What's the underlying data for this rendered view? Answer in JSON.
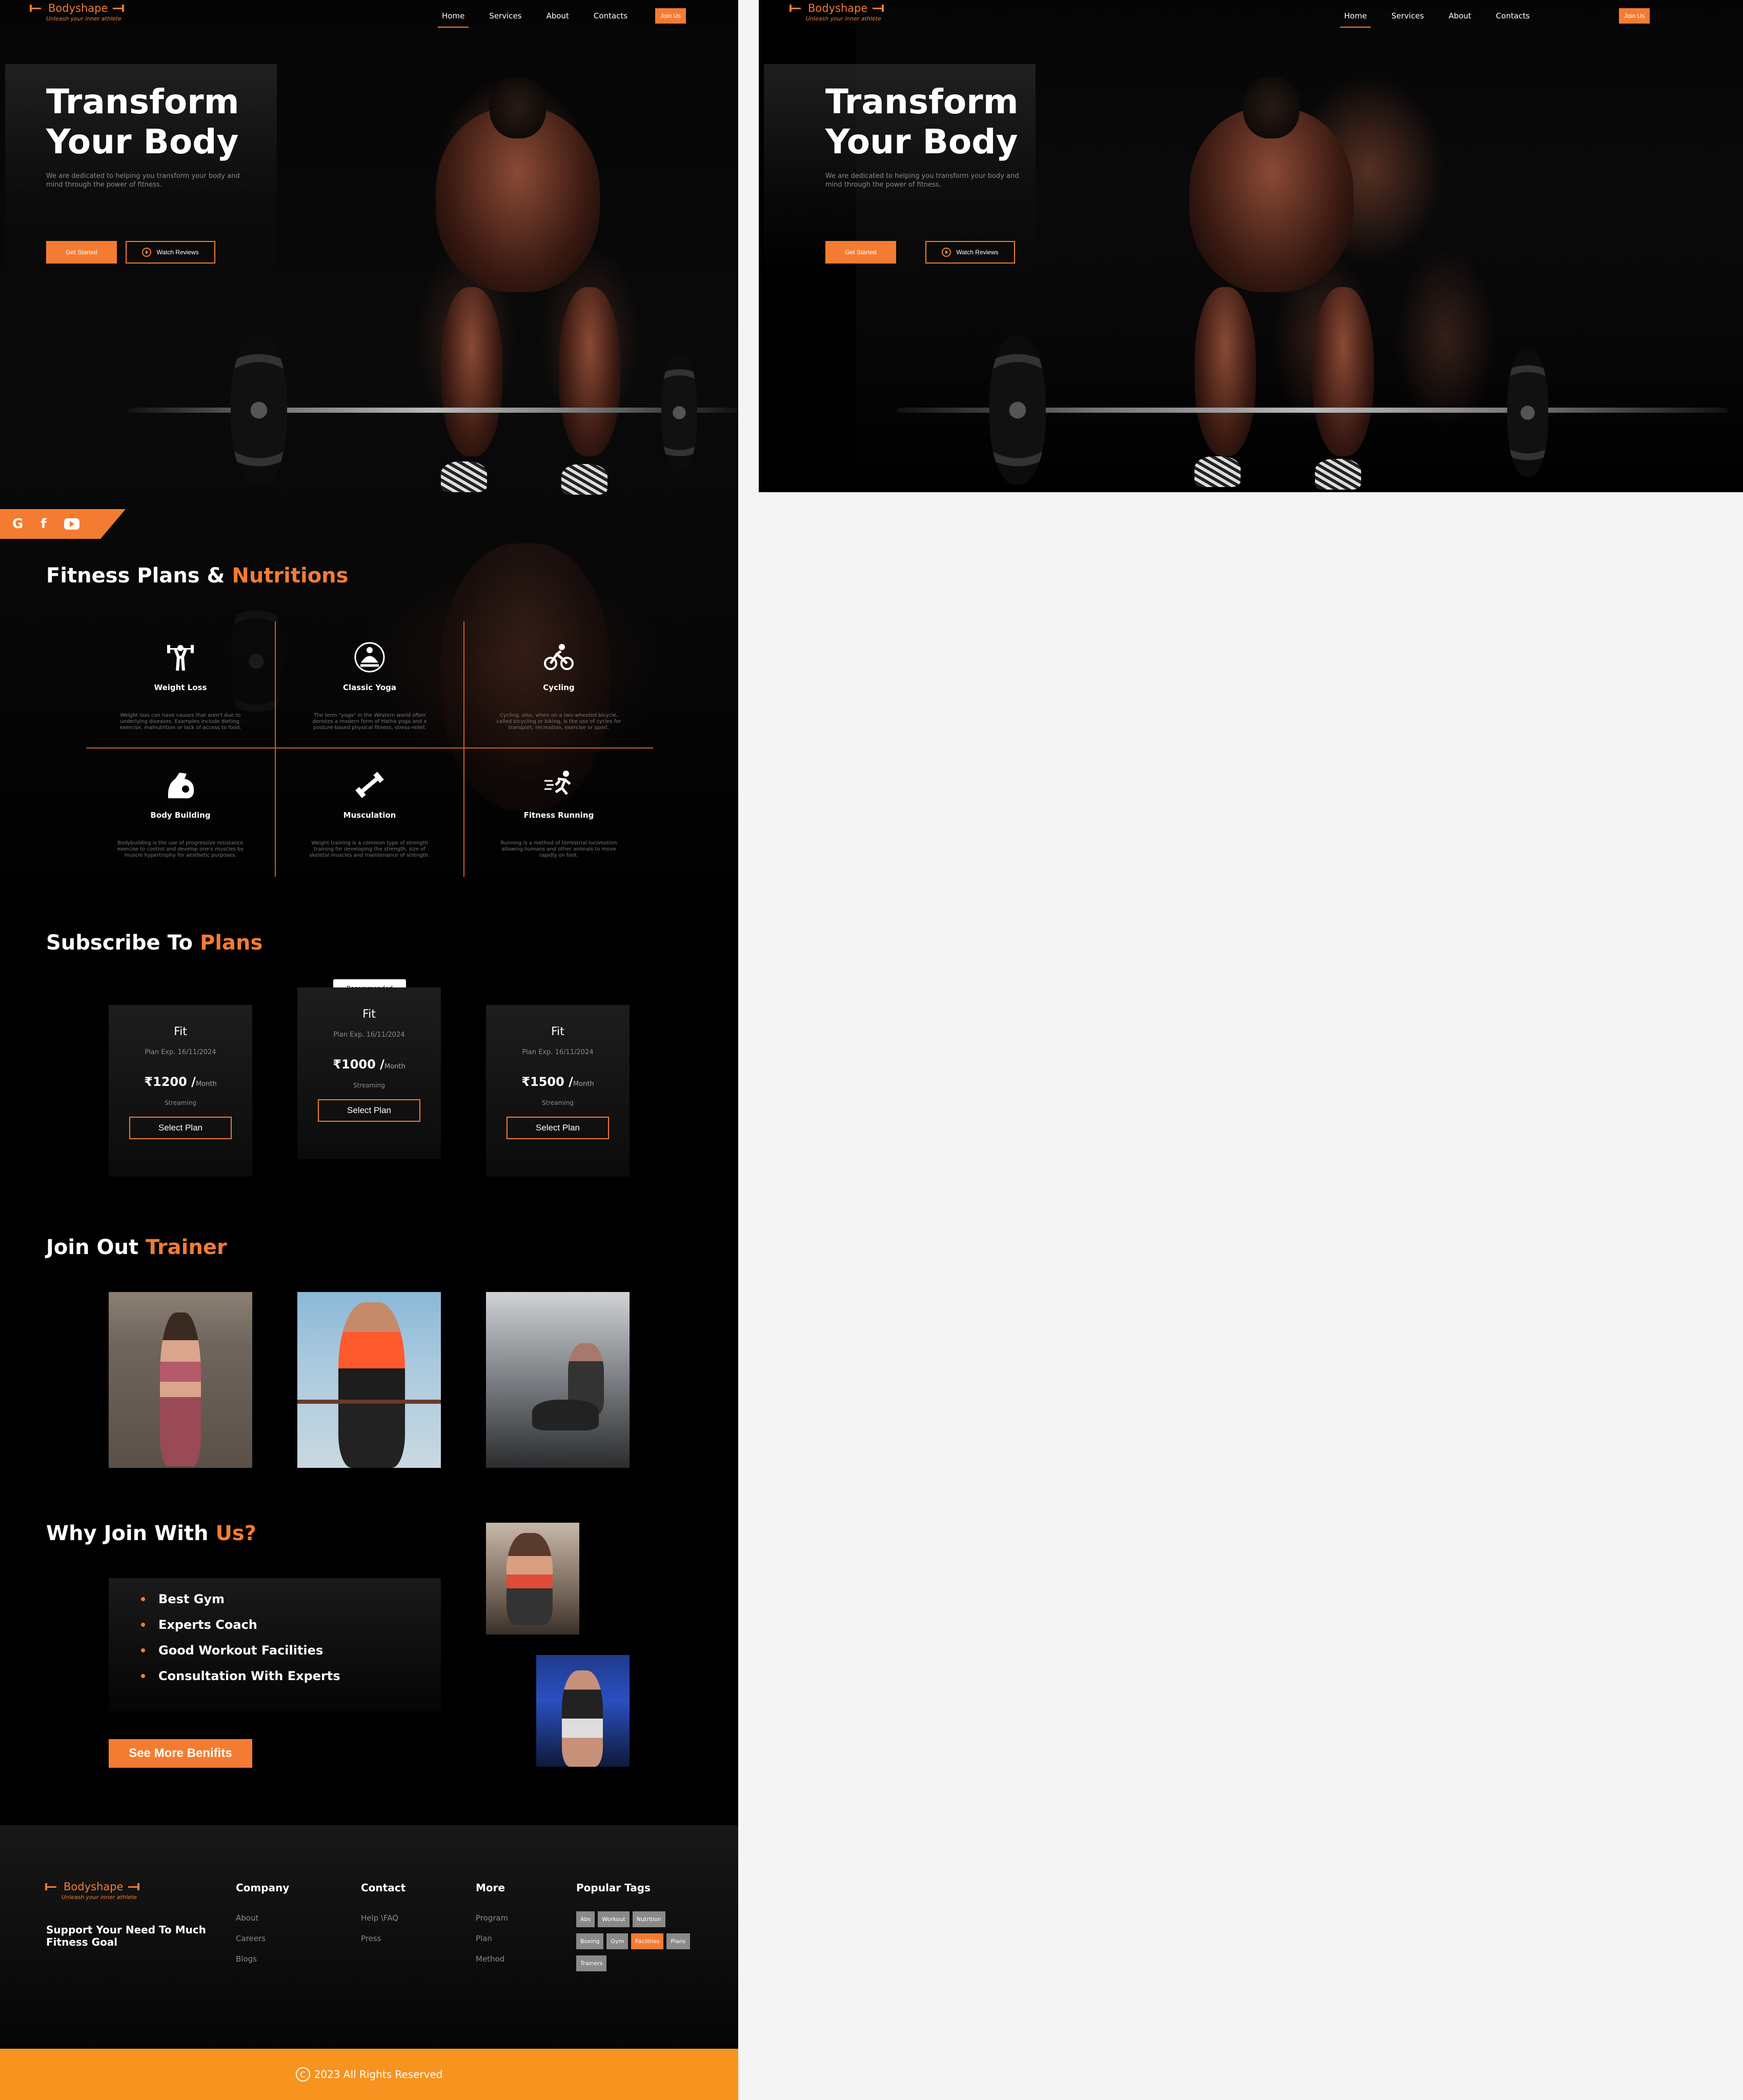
{
  "brand": {
    "name": "Bodyshape",
    "tagline": "Unleash your inner athlete"
  },
  "nav": {
    "items": [
      "Home",
      "Services",
      "About",
      "Contacts"
    ],
    "active": "Home",
    "cta": "Join Us"
  },
  "hero": {
    "title": "Transform Your Body",
    "subtitle": "We are dedicated to helping you transform your body and mind through the power of fitness.",
    "primary_button": "Get Started",
    "secondary_button": "Watch Reviews"
  },
  "social": {
    "icons": [
      "google-icon",
      "facebook-icon",
      "youtube-icon"
    ],
    "labels": [
      "G",
      "f",
      "▶"
    ]
  },
  "fitness": {
    "title_a": "Fitness Plans &",
    "title_b": "Nutritions",
    "items": [
      {
        "name": "Weight Loss",
        "icon": "weightlifter-icon",
        "desc": "Weight loss can have causes that aren't due to underlying diseases. Examples include dieting, exercise, malnutrition or lack of access to food."
      },
      {
        "name": "Classic Yoga",
        "icon": "yoga-icon",
        "desc": "The term \"yoga\" in the Western world often denotes a modern form of Hatha yoga and a posture-based physical fitness, stress-relief."
      },
      {
        "name": "Cycling",
        "icon": "cycling-icon",
        "desc": "Cycling, also, when on a two-wheeled bicycle, called bicycling or biking, is the use of cycles for transport, recreation, exercise or sport."
      },
      {
        "name": "Body Building",
        "icon": "muscle-arm-icon",
        "desc": "Bodybuilding is the use of progressive resistance exercise to control and develop one's muscles by muscle hypertrophy for aesthetic purposes."
      },
      {
        "name": "Musculation",
        "icon": "dumbbell-icon",
        "desc": "Weight training is a common type of strength training for developing the strength, size of skeletal muscles and maintenance of strength."
      },
      {
        "name": "Fitness Running",
        "icon": "runner-icon",
        "desc": "Running is a method of terrestrial locomotion allowing humans and other animals to move rapidly on foot."
      }
    ]
  },
  "plans": {
    "title_a": "Subscribe To",
    "title_b": "Plans",
    "recommended_label": "Recommended",
    "items": [
      {
        "name": "Fit",
        "expiry": "Plan Exp.  16/11/2024",
        "price": "₹1200",
        "period": "/",
        "period_unit": "Month",
        "feature": "Streaming",
        "button": "Select Plan"
      },
      {
        "name": "Fit",
        "expiry": "Plan Exp.  16/11/2024",
        "price": "₹1000",
        "period": "/",
        "period_unit": "Month",
        "feature": "Streaming",
        "button": "Select Plan"
      },
      {
        "name": "Fit",
        "expiry": "Plan Exp.  16/11/2024",
        "price": "₹1500",
        "period": "/",
        "period_unit": "Month",
        "feature": "Streaming",
        "button": "Select Plan"
      }
    ]
  },
  "trainers": {
    "title_a": "Join Out",
    "title_b": "Trainer"
  },
  "why": {
    "title_a": "Why Join With",
    "title_b": "Us?",
    "points": [
      "Best Gym",
      "Experts Coach",
      "Good Workout Facilities",
      "Consultation With Experts"
    ],
    "button": "See More Benifits"
  },
  "footer": {
    "support": "Support Your Need To Much Fitness Goal",
    "columns": [
      {
        "title": "Company",
        "links": [
          "About",
          "Careers",
          "Blogs"
        ]
      },
      {
        "title": "Contact",
        "links": [
          "Help \\FAQ",
          "Press"
        ]
      },
      {
        "title": "More",
        "links": [
          "Program",
          "Plan",
          "Method"
        ]
      }
    ],
    "tags_title": "Popular Tags",
    "tags": [
      "Abs",
      "Workout",
      "Nutrition",
      "Boxing",
      "Gym",
      "Facilities",
      "Plans",
      "Trainers"
    ],
    "highlighted_tag": "Facilities",
    "copyright_symbol": "C",
    "copyright": "2023 All Rights Reserved"
  },
  "colors": {
    "accent": "#f47c32",
    "footer_bar": "#f7931e",
    "background": "#000000"
  }
}
